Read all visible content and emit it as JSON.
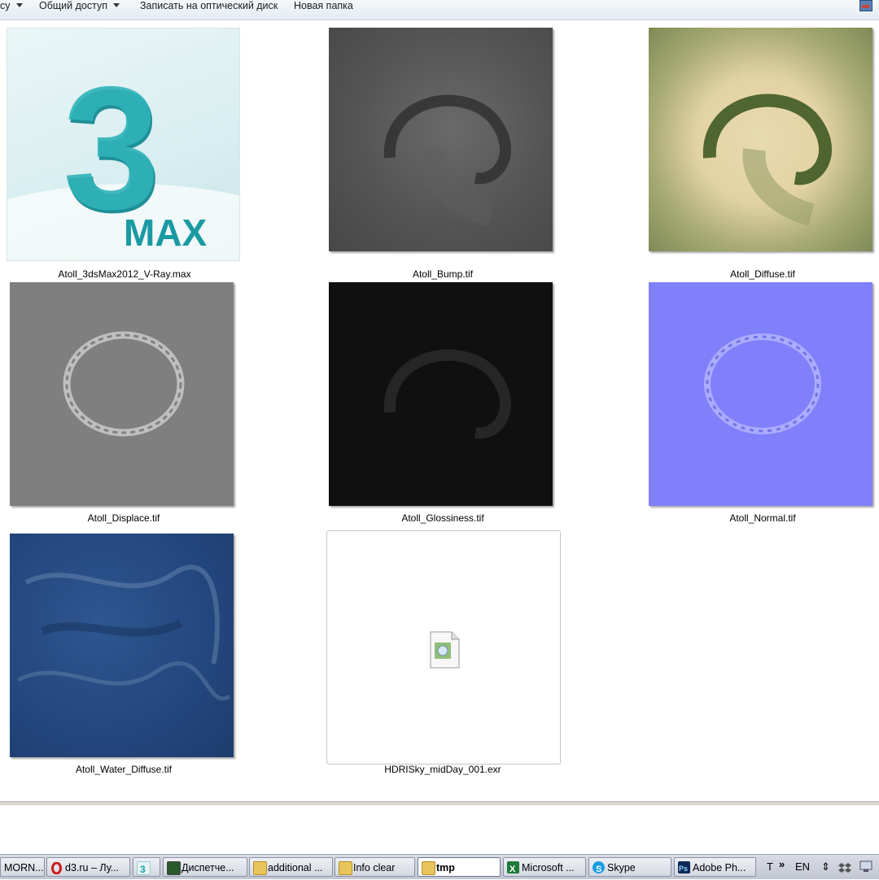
{
  "toolbar": {
    "cut_left": "cy",
    "share_label": "Общий доступ",
    "burn_label": "Записать на оптический диск",
    "new_folder_label": "Новая папка"
  },
  "files": [
    {
      "name": "Atoll_3dsMax2012_V-Ray.max",
      "thumb": "3ds-max-icon",
      "logo_digit": "3",
      "logo_text": "MAX"
    },
    {
      "name": "Atoll_Bump.tif",
      "thumb": "bump-texture"
    },
    {
      "name": "Atoll_Diffuse.tif",
      "thumb": "diffuse-texture"
    },
    {
      "name": "Atoll_Displace.tif",
      "thumb": "displace-texture"
    },
    {
      "name": "Atoll_Glossiness.tif",
      "thumb": "glossiness-texture"
    },
    {
      "name": "Atoll_Normal.tif",
      "thumb": "normal-texture"
    },
    {
      "name": "Atoll_Water_Diffuse.tif",
      "thumb": "water-texture"
    },
    {
      "name": "HDRISky_midDay_001.exr",
      "thumb": "generic-file-icon"
    }
  ],
  "taskbar": {
    "items": [
      {
        "label": "MORN...",
        "icon": "app-icon",
        "color": "#4a6fa5"
      },
      {
        "label": "d3.ru – Лу...",
        "icon": "opera-icon",
        "color": "#cc1b1b"
      },
      {
        "label": "",
        "icon": "3dsmax-icon",
        "color": "#1e9ea6"
      },
      {
        "label": "Диспетче...",
        "icon": "task-manager-icon",
        "color": "#3b7a3b"
      },
      {
        "label": "additional ...",
        "icon": "folder-icon",
        "color": "#e9c45a"
      },
      {
        "label": "Info clear",
        "icon": "folder-icon",
        "color": "#e9c45a"
      },
      {
        "label": "tmp",
        "icon": "folder-icon",
        "color": "#e9c45a",
        "active": true
      },
      {
        "label": "Microsoft ...",
        "icon": "excel-icon",
        "color": "#1f7a3a"
      },
      {
        "label": "Skype",
        "icon": "skype-icon",
        "color": "#1a9ce0"
      },
      {
        "label": "Adobe Ph...",
        "icon": "photoshop-icon",
        "color": "#0c2a56"
      }
    ],
    "tray": {
      "t_label": "T",
      "chevron": "»",
      "lang": "EN",
      "arrows": "⇕"
    }
  }
}
